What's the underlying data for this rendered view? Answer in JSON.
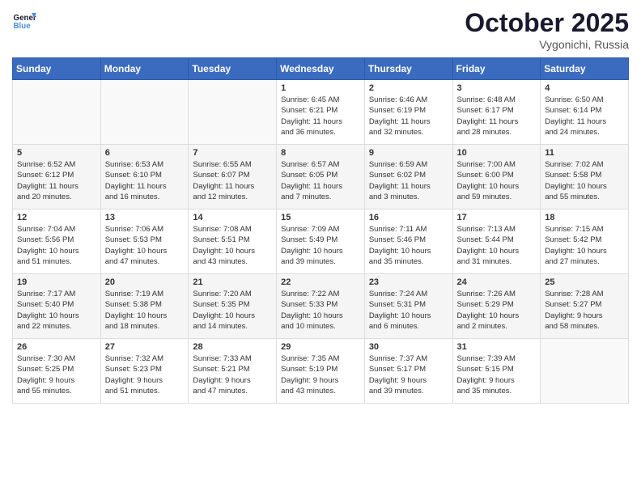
{
  "logo": {
    "line1": "General",
    "line2": "Blue"
  },
  "title": "October 2025",
  "location": "Vygonichi, Russia",
  "days_header": [
    "Sunday",
    "Monday",
    "Tuesday",
    "Wednesday",
    "Thursday",
    "Friday",
    "Saturday"
  ],
  "weeks": [
    [
      {
        "day": "",
        "info": ""
      },
      {
        "day": "",
        "info": ""
      },
      {
        "day": "",
        "info": ""
      },
      {
        "day": "1",
        "info": "Sunrise: 6:45 AM\nSunset: 6:21 PM\nDaylight: 11 hours\nand 36 minutes."
      },
      {
        "day": "2",
        "info": "Sunrise: 6:46 AM\nSunset: 6:19 PM\nDaylight: 11 hours\nand 32 minutes."
      },
      {
        "day": "3",
        "info": "Sunrise: 6:48 AM\nSunset: 6:17 PM\nDaylight: 11 hours\nand 28 minutes."
      },
      {
        "day": "4",
        "info": "Sunrise: 6:50 AM\nSunset: 6:14 PM\nDaylight: 11 hours\nand 24 minutes."
      }
    ],
    [
      {
        "day": "5",
        "info": "Sunrise: 6:52 AM\nSunset: 6:12 PM\nDaylight: 11 hours\nand 20 minutes."
      },
      {
        "day": "6",
        "info": "Sunrise: 6:53 AM\nSunset: 6:10 PM\nDaylight: 11 hours\nand 16 minutes."
      },
      {
        "day": "7",
        "info": "Sunrise: 6:55 AM\nSunset: 6:07 PM\nDaylight: 11 hours\nand 12 minutes."
      },
      {
        "day": "8",
        "info": "Sunrise: 6:57 AM\nSunset: 6:05 PM\nDaylight: 11 hours\nand 7 minutes."
      },
      {
        "day": "9",
        "info": "Sunrise: 6:59 AM\nSunset: 6:02 PM\nDaylight: 11 hours\nand 3 minutes."
      },
      {
        "day": "10",
        "info": "Sunrise: 7:00 AM\nSunset: 6:00 PM\nDaylight: 10 hours\nand 59 minutes."
      },
      {
        "day": "11",
        "info": "Sunrise: 7:02 AM\nSunset: 5:58 PM\nDaylight: 10 hours\nand 55 minutes."
      }
    ],
    [
      {
        "day": "12",
        "info": "Sunrise: 7:04 AM\nSunset: 5:56 PM\nDaylight: 10 hours\nand 51 minutes."
      },
      {
        "day": "13",
        "info": "Sunrise: 7:06 AM\nSunset: 5:53 PM\nDaylight: 10 hours\nand 47 minutes."
      },
      {
        "day": "14",
        "info": "Sunrise: 7:08 AM\nSunset: 5:51 PM\nDaylight: 10 hours\nand 43 minutes."
      },
      {
        "day": "15",
        "info": "Sunrise: 7:09 AM\nSunset: 5:49 PM\nDaylight: 10 hours\nand 39 minutes."
      },
      {
        "day": "16",
        "info": "Sunrise: 7:11 AM\nSunset: 5:46 PM\nDaylight: 10 hours\nand 35 minutes."
      },
      {
        "day": "17",
        "info": "Sunrise: 7:13 AM\nSunset: 5:44 PM\nDaylight: 10 hours\nand 31 minutes."
      },
      {
        "day": "18",
        "info": "Sunrise: 7:15 AM\nSunset: 5:42 PM\nDaylight: 10 hours\nand 27 minutes."
      }
    ],
    [
      {
        "day": "19",
        "info": "Sunrise: 7:17 AM\nSunset: 5:40 PM\nDaylight: 10 hours\nand 22 minutes."
      },
      {
        "day": "20",
        "info": "Sunrise: 7:19 AM\nSunset: 5:38 PM\nDaylight: 10 hours\nand 18 minutes."
      },
      {
        "day": "21",
        "info": "Sunrise: 7:20 AM\nSunset: 5:35 PM\nDaylight: 10 hours\nand 14 minutes."
      },
      {
        "day": "22",
        "info": "Sunrise: 7:22 AM\nSunset: 5:33 PM\nDaylight: 10 hours\nand 10 minutes."
      },
      {
        "day": "23",
        "info": "Sunrise: 7:24 AM\nSunset: 5:31 PM\nDaylight: 10 hours\nand 6 minutes."
      },
      {
        "day": "24",
        "info": "Sunrise: 7:26 AM\nSunset: 5:29 PM\nDaylight: 10 hours\nand 2 minutes."
      },
      {
        "day": "25",
        "info": "Sunrise: 7:28 AM\nSunset: 5:27 PM\nDaylight: 9 hours\nand 58 minutes."
      }
    ],
    [
      {
        "day": "26",
        "info": "Sunrise: 7:30 AM\nSunset: 5:25 PM\nDaylight: 9 hours\nand 55 minutes."
      },
      {
        "day": "27",
        "info": "Sunrise: 7:32 AM\nSunset: 5:23 PM\nDaylight: 9 hours\nand 51 minutes."
      },
      {
        "day": "28",
        "info": "Sunrise: 7:33 AM\nSunset: 5:21 PM\nDaylight: 9 hours\nand 47 minutes."
      },
      {
        "day": "29",
        "info": "Sunrise: 7:35 AM\nSunset: 5:19 PM\nDaylight: 9 hours\nand 43 minutes."
      },
      {
        "day": "30",
        "info": "Sunrise: 7:37 AM\nSunset: 5:17 PM\nDaylight: 9 hours\nand 39 minutes."
      },
      {
        "day": "31",
        "info": "Sunrise: 7:39 AM\nSunset: 5:15 PM\nDaylight: 9 hours\nand 35 minutes."
      },
      {
        "day": "",
        "info": ""
      }
    ]
  ]
}
